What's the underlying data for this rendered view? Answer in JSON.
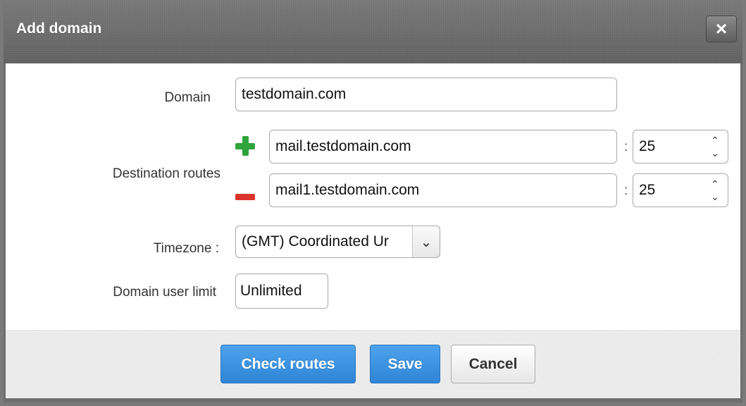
{
  "dialog": {
    "title": "Add domain",
    "close_icon": "×"
  },
  "form": {
    "domain_label": "Domain",
    "domain_value": "testdomain.com",
    "routes_label": "Destination routes",
    "routes": [
      {
        "host": "mail.testdomain.com",
        "port": "25",
        "action_icon": "plus-icon"
      },
      {
        "host": "mail1.testdomain.com",
        "port": "25",
        "action_icon": "minus-icon"
      }
    ],
    "port_separator": ":",
    "timezone_label": "Timezone :",
    "timezone_value": "(GMT) Coordinated Ur",
    "user_limit_label": "Domain user limit",
    "user_limit_value": "Unlimited"
  },
  "footer": {
    "check_routes_label": "Check routes",
    "save_label": "Save",
    "cancel_label": "Cancel"
  },
  "colors": {
    "primary": "#3a8fe0",
    "add": "#2ea43b",
    "remove": "#d9342b"
  }
}
